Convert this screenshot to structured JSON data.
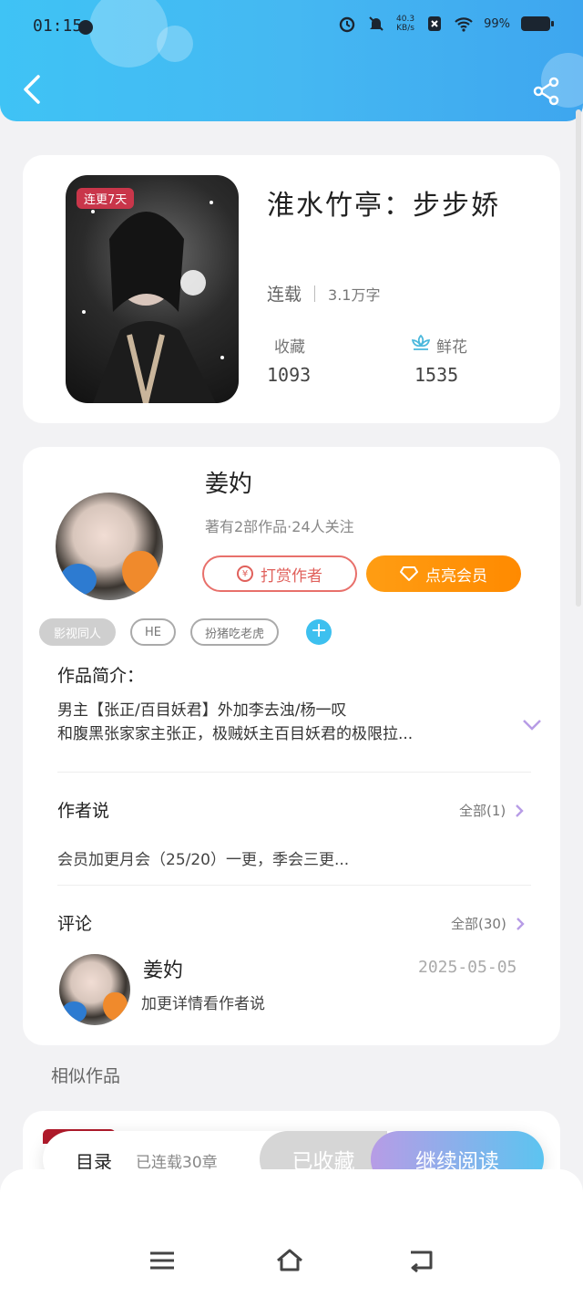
{
  "status_bar": {
    "time": "01:15",
    "net_speed_top": "40.3",
    "net_speed_unit": "KB/s",
    "battery": "99%"
  },
  "header": {
    "back_icon": "chevron-left-icon",
    "share_icon": "share-icon"
  },
  "book": {
    "badge": "连更7天",
    "title": "淮水竹亭：步步娇",
    "status": "连载",
    "word_count": "3.1万字",
    "favorites_label": "收藏",
    "favorites_value": "1093",
    "flowers_label": "鲜花",
    "flowers_value": "1535"
  },
  "author": {
    "name": "姜妁",
    "meta": "著有2部作品·24人关注",
    "tip_button": "打赏作者",
    "vip_button": "点亮会员",
    "tags": [
      "影视同人",
      "HE",
      "扮猪吃老虎"
    ],
    "add_tag": "+"
  },
  "intro": {
    "title": "作品简介：",
    "line1": "男主【张正/百目妖君】外加李去浊/杨一叹",
    "line2": "和腹黑张家家主张正，极贼妖主百目妖君的极限拉..."
  },
  "author_says": {
    "title": "作者说",
    "more": "全部(1)",
    "text": "会员加更月会（25/20）一更，季会三更..."
  },
  "comments": {
    "title": "评论",
    "more": "全部(30)",
    "items": [
      {
        "name": "姜妁",
        "date": "2025-05-05",
        "text": "加更详情看作者说"
      }
    ]
  },
  "similar": {
    "title": "相似作品"
  },
  "action_bar": {
    "toc": "目录",
    "count": "已连载30章",
    "fav": "已收藏",
    "read": "继续阅读"
  },
  "colors": {
    "header": "#45b8f2",
    "accent_orange": "#ff8a00",
    "tip_red": "#e0605b",
    "add_blue": "#3dc0ef"
  }
}
